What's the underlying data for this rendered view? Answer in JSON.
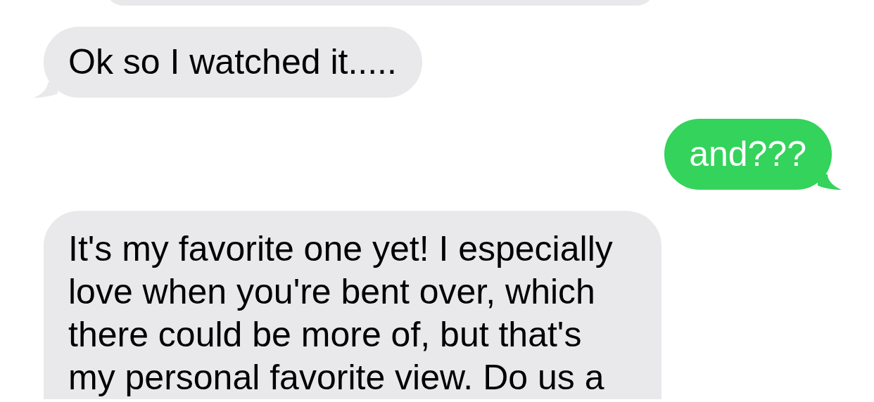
{
  "messages": [
    {
      "kind": "received"
    },
    {
      "kind": "received",
      "text": "Ok so I watched it.....",
      "tail": true
    },
    {
      "kind": "sent",
      "text": "and???",
      "tail": true
    },
    {
      "kind": "received",
      "text": "It's my favorite one yet! I especially love when you're bent over, which there could be more of, but that's my personal favorite view. Do us a"
    }
  ]
}
